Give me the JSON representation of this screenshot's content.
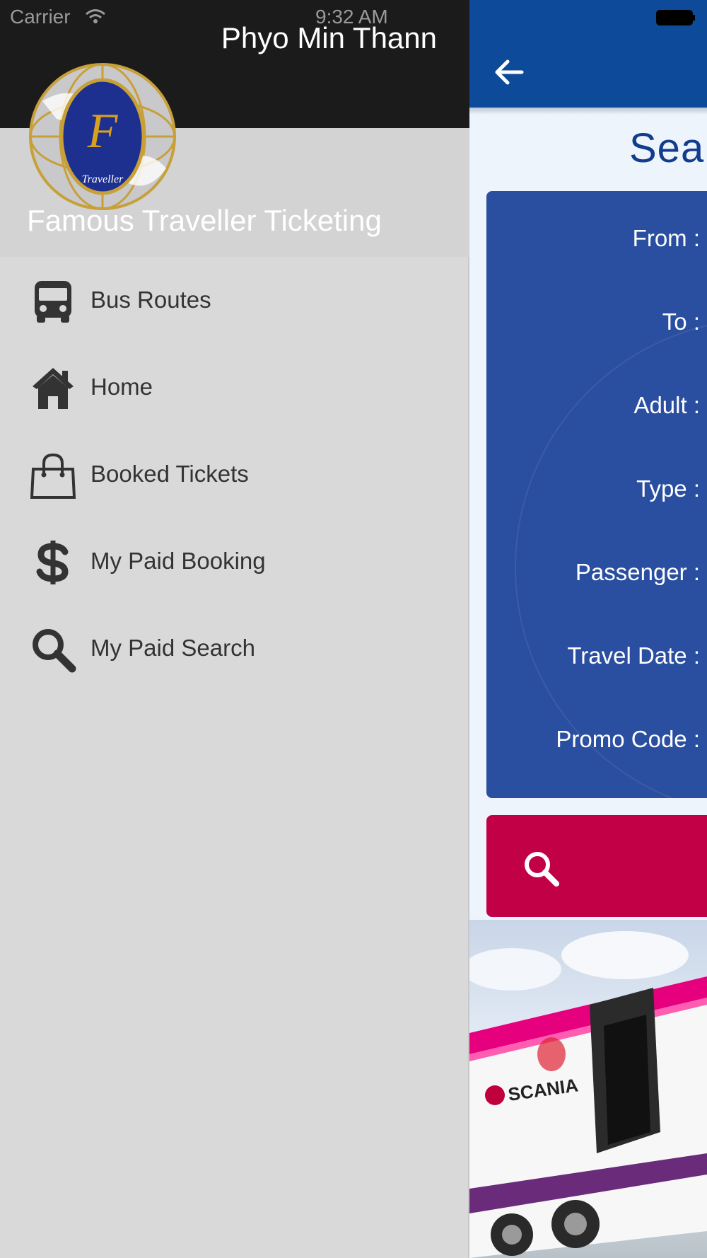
{
  "status_bar": {
    "carrier": "Carrier",
    "time": "9:32 AM"
  },
  "drawer": {
    "user_name": "Phyo Min Thann",
    "app_name": "Famous Traveller Ticketing",
    "logo_text": "Traveller",
    "items": [
      {
        "label": "Bus Routes",
        "icon": "bus-icon"
      },
      {
        "label": "Home",
        "icon": "home-icon"
      },
      {
        "label": "Booked Tickets",
        "icon": "shopping-bag-icon"
      },
      {
        "label": "My Paid Booking",
        "icon": "dollar-icon"
      },
      {
        "label": "My Paid Search",
        "icon": "search-icon"
      }
    ]
  },
  "main": {
    "title": "Sea",
    "fields": [
      {
        "label": "From :"
      },
      {
        "label": "To :"
      },
      {
        "label": "Adult :"
      },
      {
        "label": "Type :"
      },
      {
        "label": "Passenger :"
      },
      {
        "label": "Travel Date :"
      },
      {
        "label": "Promo Code :"
      }
    ],
    "bus_brand": "SCANIA"
  },
  "colors": {
    "app_bar": "#0d4b9a",
    "form_panel": "#2a4fa0",
    "search_button": "#c20046",
    "drawer_background": "#d9d9d9",
    "drawer_top": "#1b1b1b"
  }
}
